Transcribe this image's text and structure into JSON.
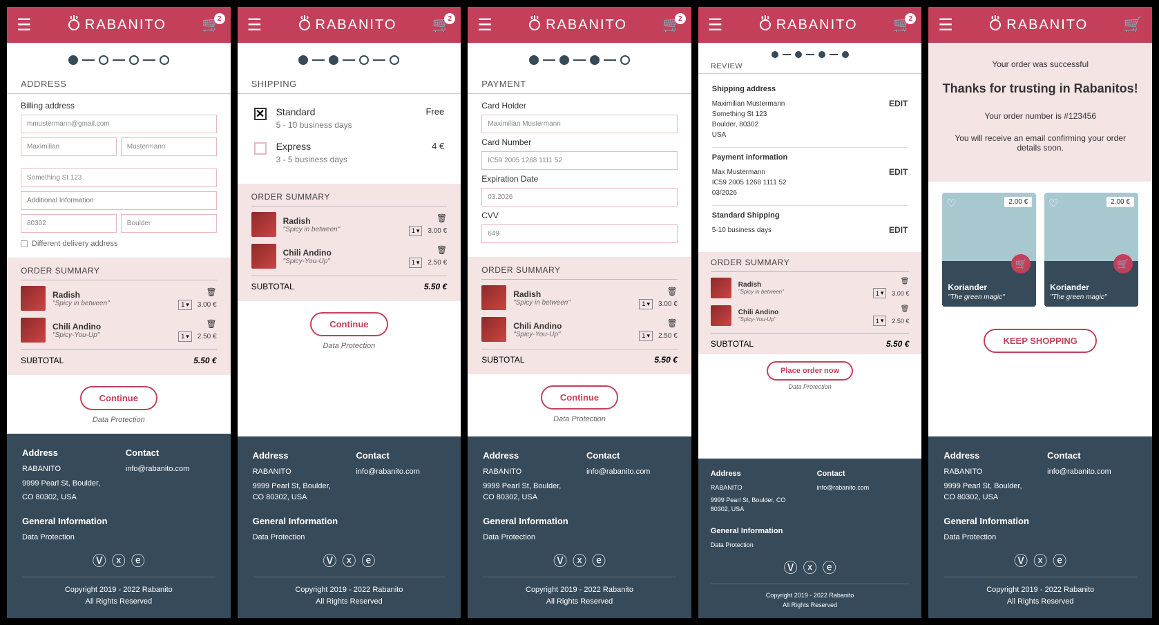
{
  "brand": "RABANITO",
  "cart_count": "2",
  "screens": {
    "address": {
      "title": "ADDRESS",
      "sub": "Billing address",
      "email": "mmustermann@gmail.com",
      "first": "Maximilian",
      "last": "Mustermann",
      "street": "Something St 123",
      "addl": "Additional Information",
      "zip": "80302",
      "city": "Boulder",
      "diff": "Different delivery address"
    },
    "shipping": {
      "title": "SHIPPING",
      "opt1": {
        "name": "Standard",
        "days": "5 - 10 business days",
        "price": "Free"
      },
      "opt2": {
        "name": "Express",
        "days": "3 - 5 business days",
        "price": "4 €"
      }
    },
    "payment": {
      "title": "PAYMENT",
      "holder_label": "Card Holder",
      "holder": "Maximilian Mustermann",
      "number_label": "Card Number",
      "number": "IC59 2005 1268 1111 52",
      "exp_label": "Expiration Date",
      "exp": "03.2026",
      "cvv_label": "CVV",
      "cvv": "649"
    },
    "review": {
      "title": "REVIEW",
      "ship_h": "Shipping address",
      "ship_name": "Maximilian Mustermann",
      "ship_street": "Something St 123",
      "ship_city": "Boulder, 80302",
      "ship_country": "USA",
      "pay_h": "Payment information",
      "pay_name": "Max Mustermann",
      "pay_num": "IC59 2005 1268 1111 52",
      "pay_exp": "03/2026",
      "method_h": "Standard Shipping",
      "method_days": "5-10 business days",
      "edit": "EDIT",
      "place": "Place order now"
    },
    "success": {
      "msg": "Your order was successful",
      "thanks": "Thanks for trusting in Rabanitos!",
      "ordnum": "Your order number is #123456",
      "email": "You will receive an email confirming your order details soon.",
      "keep": "KEEP SHOPPING",
      "prod_name": "Koriander",
      "prod_tag": "\"The green magic\"",
      "prod_price": "2.00 €"
    }
  },
  "summary": {
    "title": "ORDER SUMMARY",
    "item1": {
      "name": "Radish",
      "tag": "\"Spicy in between\"",
      "qty": "1",
      "price": "3.00 €"
    },
    "item2": {
      "name": "Chili Andino",
      "tag": "\"Spicy-You-Up\"",
      "qty": "1",
      "price": "2.50 €"
    },
    "subtotal_label": "SUBTOTAL",
    "subtotal": "5.50 €"
  },
  "btn_continue": "Continue",
  "link_dp": "Data Protection",
  "footer": {
    "addr_h": "Address",
    "addr_1": "RABANITO",
    "addr_2": "9999 Pearl St, Boulder,",
    "addr_3": "CO 80302, USA",
    "addr_2b": "9999 Pearl St, Boulder, CO 80302, USA",
    "contact_h": "Contact",
    "contact_email": "info@rabanito.com",
    "gen_h": "General Information",
    "gen_link": "Data Protection",
    "copy1": "Copyright 2019 - 2022 Rabanito",
    "copy2": "All Rights Reserved"
  }
}
